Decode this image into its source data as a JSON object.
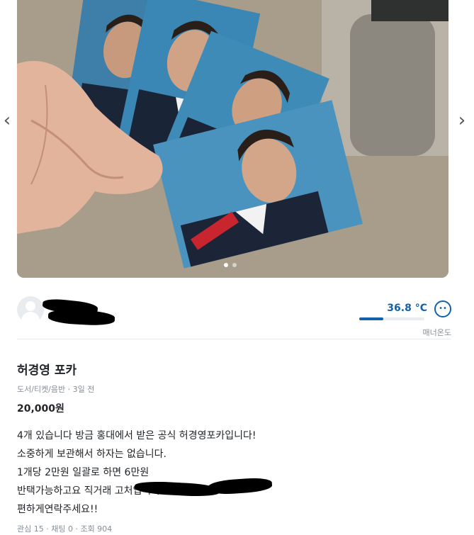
{
  "carousel": {
    "image_description_icon": "photo-of-photo-cards",
    "prev_icon": "chevron-left-icon",
    "next_icon": "chevron-right-icon",
    "prev_glyph": "‹",
    "next_glyph": "›",
    "page_count": 2,
    "active_page": 1
  },
  "seller": {
    "name": " ",
    "manner_temp": "36.8 °C",
    "manner_label": "매너온도",
    "manner_fraction": 0.368,
    "manner_face": "••",
    "accent_color": "#1561a9"
  },
  "article": {
    "title": "허경영 포카",
    "meta": "도서/티켓/음반 · 3일 전",
    "price": "20,000원",
    "description": [
      "4개 있습니다 방금 홍대에서 받은 공식 허경영포카입니다!",
      "소중하게 보관해서 하자는 없습니다.",
      "1개당 2만원 일괄로 하면 6만원",
      "반택가능하고요 직거래                                          고처입니다.",
      "편하게연락주세요!!"
    ],
    "counts": "관심 15 · 채팅 0 · 조회 904"
  }
}
